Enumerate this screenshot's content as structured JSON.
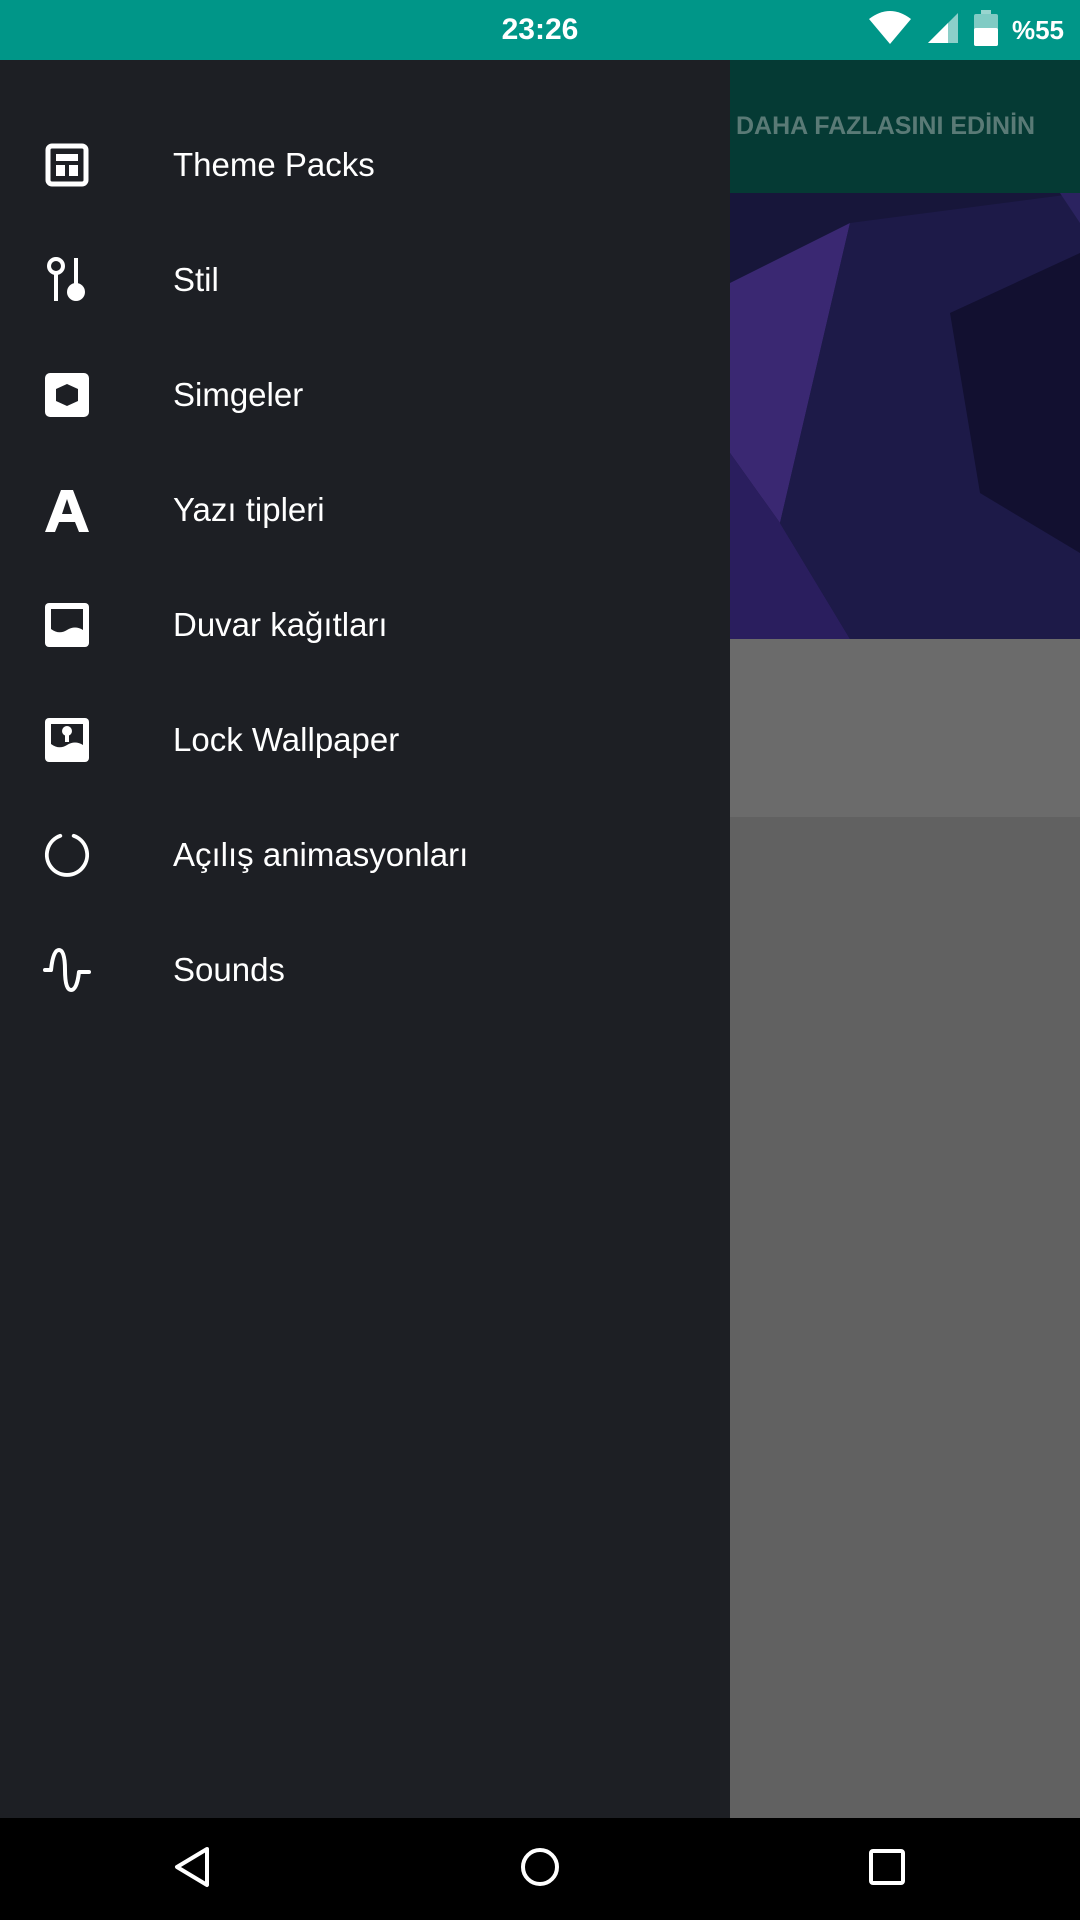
{
  "status_bar": {
    "time": "23:26",
    "battery_text": "%55",
    "icons": [
      "wifi-icon",
      "signal-icon",
      "battery-icon"
    ]
  },
  "background_app": {
    "toolbar_action": "DAHA FAZLASINI EDİNİN"
  },
  "drawer": {
    "items": [
      {
        "label": "Theme Packs",
        "icon": "theme-packs-icon"
      },
      {
        "label": "Stil",
        "icon": "style-icon"
      },
      {
        "label": "Simgeler",
        "icon": "icons-icon"
      },
      {
        "label": "Yazı tipleri",
        "icon": "font-icon"
      },
      {
        "label": "Duvar kağıtları",
        "icon": "wallpaper-icon"
      },
      {
        "label": "Lock Wallpaper",
        "icon": "lock-wallpaper-icon"
      },
      {
        "label": "Açılış animasyonları",
        "icon": "boot-animation-icon"
      },
      {
        "label": "Sounds",
        "icon": "sounds-icon"
      }
    ]
  },
  "nav_bar": {
    "buttons": [
      "back-icon",
      "home-icon",
      "recents-icon"
    ]
  },
  "colors": {
    "status_bar": "#009688",
    "drawer_bg": "#1d1f24",
    "toolbar_bg": "#053a34",
    "scrim": "#616161"
  }
}
